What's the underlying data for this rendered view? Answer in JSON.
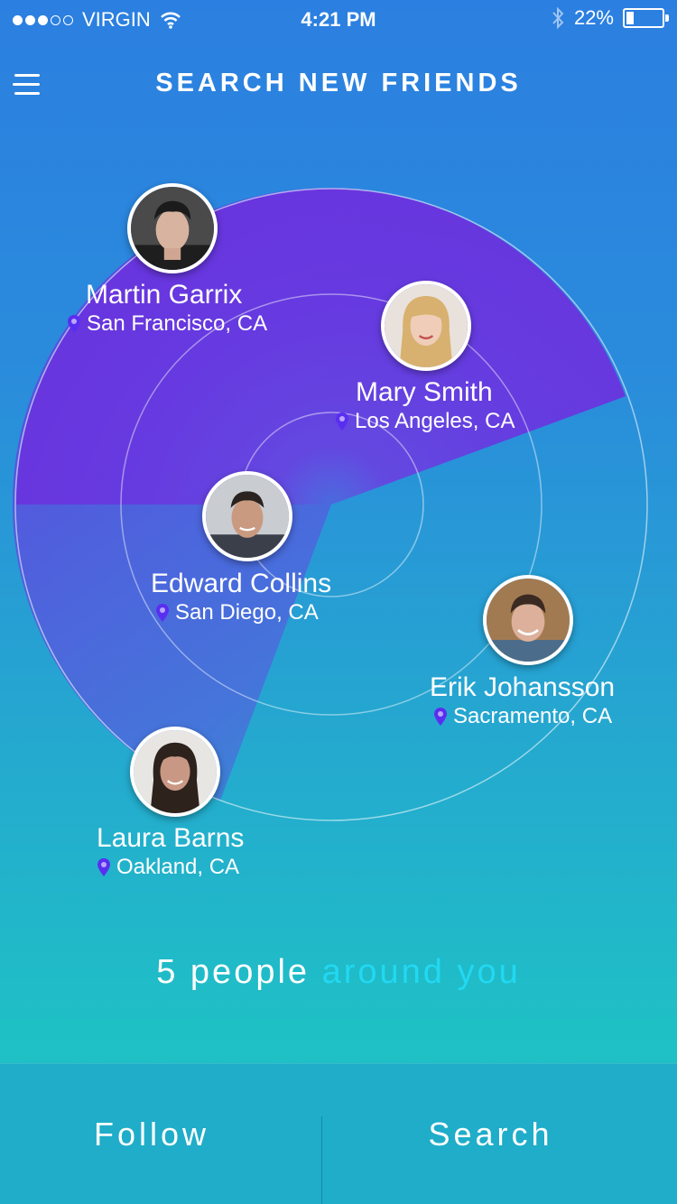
{
  "status_bar": {
    "carrier": "VIRGIN",
    "time": "4:21 PM",
    "battery": "22%",
    "battery_level": 0.22,
    "icons": [
      "signal-dots-icon",
      "wifi-icon",
      "bluetooth-icon",
      "battery-icon"
    ]
  },
  "header": {
    "title": "SEARCH NEW FRIENDS",
    "menu_icon": "hamburger-menu-icon"
  },
  "colors": {
    "background_top": "#2b7fe0",
    "background_bottom": "#1ec3c3",
    "radar_sweep": "#6a35e0",
    "pin": "#5a2ef0",
    "accent_text": "#22d8f2",
    "bottom_bar": "#1fadc9"
  },
  "friends": [
    {
      "name": "Martin Garrix",
      "location": "San Francisco, CA"
    },
    {
      "name": "Mary Smith",
      "location": "Los Angeles, CA"
    },
    {
      "name": "Edward Collins",
      "location": "San Diego, CA"
    },
    {
      "name": "Erik Johansson",
      "location": "Sacramento, CA"
    },
    {
      "name": "Laura Barns",
      "location": "Oakland, CA"
    }
  ],
  "summary": {
    "count": "5",
    "people": "people",
    "around_you": "around you"
  },
  "actions": {
    "follow": "Follow",
    "search": "Search"
  }
}
